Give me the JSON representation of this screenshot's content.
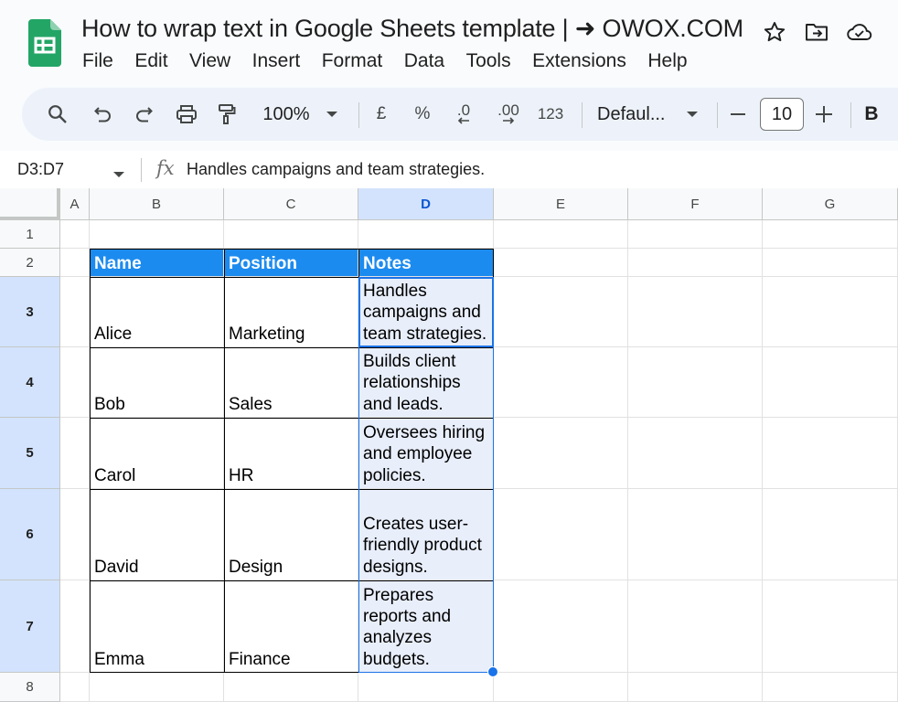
{
  "app": {
    "doc_title": "How to wrap text in Google Sheets template | ➜ OWOX.COM",
    "brand_color": "#23a566"
  },
  "menu": [
    "File",
    "Edit",
    "View",
    "Insert",
    "Format",
    "Data",
    "Tools",
    "Extensions",
    "Help"
  ],
  "toolbar": {
    "zoom": "100%",
    "currency": "£",
    "percent": "%",
    "decrease_decimal": ".0",
    "increase_decimal": ".00",
    "more_formats": "123",
    "font": "Defaul...",
    "font_size": "10",
    "bold": "B"
  },
  "formula_bar": {
    "name_box": "D3:D7",
    "fx": "fx",
    "value": "Handles campaigns and team strategies."
  },
  "columns": [
    "A",
    "B",
    "C",
    "D",
    "E",
    "F",
    "G"
  ],
  "rows": [
    "1",
    "2",
    "3",
    "4",
    "5",
    "6",
    "7",
    "8"
  ],
  "table": {
    "headers": [
      "Name",
      "Position",
      "Notes"
    ],
    "rows": [
      [
        "Alice",
        "Marketing",
        "Handles campaigns and team strategies."
      ],
      [
        "Bob",
        "Sales",
        "Builds client relationships and leads."
      ],
      [
        "Carol",
        "HR",
        "Oversees hiring and employee policies."
      ],
      [
        "David",
        "Design",
        "Creates user-friendly product designs."
      ],
      [
        "Emma",
        "Finance",
        "Prepares reports and analyzes budgets."
      ]
    ],
    "header_color": "#1c8bef"
  },
  "selection": {
    "color": "#1a73e8",
    "selected_column": "D",
    "selected_rows": [
      "3",
      "4",
      "5",
      "6",
      "7"
    ]
  }
}
